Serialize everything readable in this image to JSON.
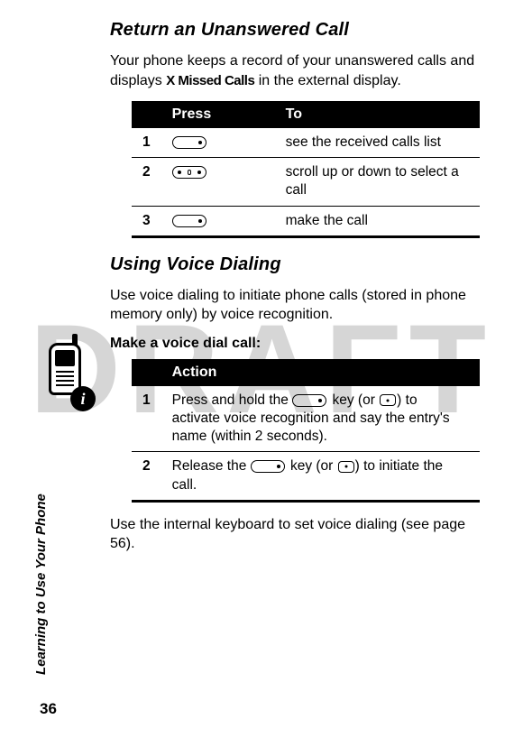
{
  "watermark": "DRAFT",
  "side_label": "Learning to Use Your Phone",
  "page_number": "36",
  "section1": {
    "heading": "Return an Unanswered Call",
    "intro_before": "Your phone keeps a record of your unanswered calls and displays ",
    "intro_bold": "X Missed Calls",
    "intro_after": " in the external display.",
    "table": {
      "head_press": "Press",
      "head_to": "To",
      "rows": [
        {
          "num": "1",
          "to": "see the received calls list"
        },
        {
          "num": "2",
          "to": "scroll up or down to select a call"
        },
        {
          "num": "3",
          "to": "make the call"
        }
      ]
    }
  },
  "section2": {
    "heading": "Using Voice Dialing",
    "intro": "Use voice dialing to initiate phone calls (stored in phone memory only) by voice recognition.",
    "lead": "Make a voice dial call:",
    "table": {
      "head_action": "Action",
      "rows": [
        {
          "num": "1",
          "pre": "Press and hold the ",
          "mid": " key (or ",
          "post": ") to activate voice recognition and say the entry's name (within 2 seconds)."
        },
        {
          "num": "2",
          "pre": "Release the ",
          "mid": " key (or ",
          "post": ") to initiate the call."
        }
      ]
    },
    "outro": "Use the internal keyboard to set voice dialing (see page 56)."
  }
}
